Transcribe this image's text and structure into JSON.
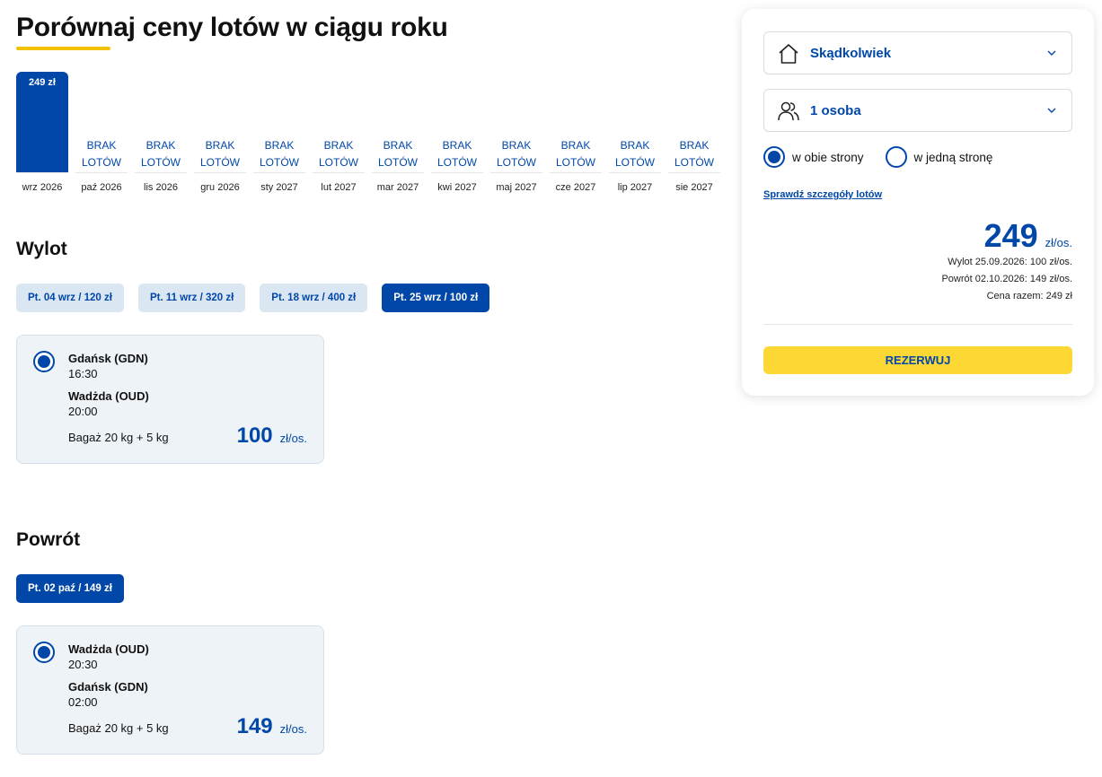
{
  "page": {
    "title": "Porównaj ceny lotów w ciągu roku"
  },
  "calendar": {
    "months": [
      {
        "label": "wrz 2026",
        "price": "249 zł",
        "available": true
      },
      {
        "label": "paź 2026",
        "no_flights": "BRAK LOTÓW",
        "available": false
      },
      {
        "label": "lis 2026",
        "no_flights": "BRAK LOTÓW",
        "available": false
      },
      {
        "label": "gru 2026",
        "no_flights": "BRAK LOTÓW",
        "available": false
      },
      {
        "label": "sty 2027",
        "no_flights": "BRAK LOTÓW",
        "available": false
      },
      {
        "label": "lut 2027",
        "no_flights": "BRAK LOTÓW",
        "available": false
      },
      {
        "label": "mar 2027",
        "no_flights": "BRAK LOTÓW",
        "available": false
      },
      {
        "label": "kwi 2027",
        "no_flights": "BRAK LOTÓW",
        "available": false
      },
      {
        "label": "maj 2027",
        "no_flights": "BRAK LOTÓW",
        "available": false
      },
      {
        "label": "cze 2027",
        "no_flights": "BRAK LOTÓW",
        "available": false
      },
      {
        "label": "lip 2027",
        "no_flights": "BRAK LOTÓW",
        "available": false
      },
      {
        "label": "sie 2027",
        "no_flights": "BRAK LOTÓW",
        "available": false
      }
    ]
  },
  "outbound": {
    "heading": "Wylot",
    "dates": [
      {
        "label": "Pt. 04 wrz / 120 zł",
        "selected": false
      },
      {
        "label": "Pt. 11 wrz / 320 zł",
        "selected": false
      },
      {
        "label": "Pt. 18 wrz / 400 zł",
        "selected": false
      },
      {
        "label": "Pt. 25 wrz / 100 zł",
        "selected": true
      }
    ],
    "flight": {
      "from": "Gdańsk (GDN)",
      "depart_time": "16:30",
      "to": "Wadżda (OUD)",
      "arrive_time": "20:00",
      "baggage": "Bagaż 20 kg + 5 kg",
      "price": "100",
      "unit": "zł/os."
    }
  },
  "return": {
    "heading": "Powrót",
    "dates": [
      {
        "label": "Pt. 02 paź / 149 zł",
        "selected": true
      }
    ],
    "flight": {
      "from": "Wadżda (OUD)",
      "depart_time": "20:30",
      "to": "Gdańsk (GDN)",
      "arrive_time": "02:00",
      "baggage": "Bagaż 20 kg + 5 kg",
      "price": "149",
      "unit": "zł/os."
    }
  },
  "panel": {
    "origin": "Skądkolwiek",
    "passengers": "1 osoba",
    "trip_round": "w obie strony",
    "trip_oneway": "w jedną stronę",
    "details_link": "Sprawdź szczegóły lotów",
    "total_price": "249",
    "total_unit": "zł/os.",
    "outbound_line": "Wylot 25.09.2026: 100 zł/os.",
    "return_line": "Powrót 02.10.2026: 149 zł/os.",
    "total_line": "Cena razem: 249 zł",
    "book_label": "REZERWUJ"
  },
  "colors": {
    "brand_blue": "#0047a8",
    "accent_yellow": "#fdd835",
    "chip_bg": "#dbe6f3"
  }
}
